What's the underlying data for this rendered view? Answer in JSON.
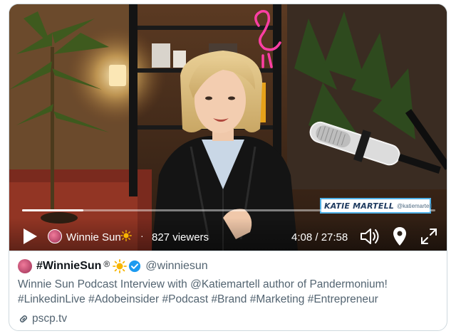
{
  "video": {
    "name_tag": {
      "name": "KATIE MARTELL",
      "handle": "@katiemartell"
    },
    "controls": {
      "play_icon": "play-icon",
      "host_name": "Winnie Sun",
      "host_emoji": "sun-icon",
      "separator": "·",
      "viewers": "827 viewers",
      "timecode": "4:08 / 27:58",
      "progress_fraction": 0.148,
      "volume_icon": "volume-icon",
      "location_icon": "location-pin-icon",
      "fullscreen_icon": "fullscreen-icon"
    }
  },
  "tweet": {
    "author_name": "#WinnieSun",
    "registered_mark": "®",
    "handle": "@winniesun",
    "verified": true,
    "description": "Winnie Sun Podcast Interview with @Katiemartell author of Pandermonium! #LinkedinLive #Adobeinsider #Podcast #Brand #Marketing #Entrepreneur",
    "link_text": "pscp.tv"
  },
  "colors": {
    "verified_blue": "#1d9bf0",
    "name_tag_border": "#4fb0e6",
    "neon_pink": "#ff3fa4",
    "sun_yellow": "#f7b500"
  }
}
